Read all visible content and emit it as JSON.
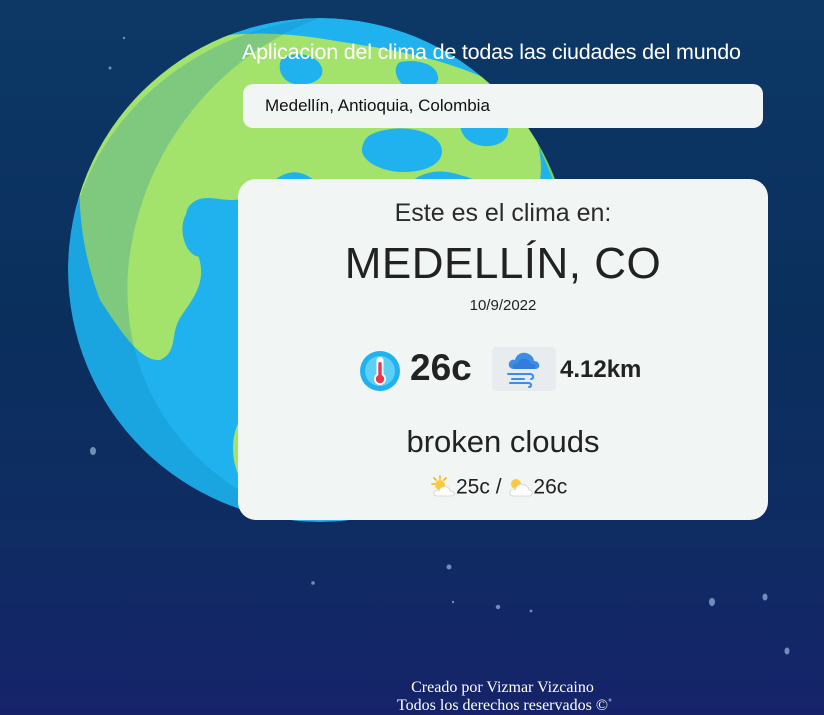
{
  "header": {
    "title": "Aplicacion del clima de todas las ciudades del mundo"
  },
  "search": {
    "value": "Medellín, Antioquia, Colombia",
    "placeholder": ""
  },
  "weather_card": {
    "heading": "Este es el clima en:",
    "city": "MEDELLÍN, CO",
    "date": "10/9/2022",
    "temperature": "26c",
    "wind": "4.12km",
    "description": "broken clouds",
    "min_temp": "25c",
    "separator": "/",
    "max_temp": "26c"
  },
  "icons": {
    "background": "earth-globe-icon",
    "temperature": "thermometer-icon",
    "wind": "cloud-wind-icon",
    "min": "sun-behind-cloud-icon",
    "max": "sun-behind-large-cloud-icon"
  },
  "footer": {
    "line1": "Creado por Vizmar Vizcaino",
    "line2": "Todos los derechos reservados ©"
  },
  "colors": {
    "background_top": "#0d3866",
    "background_bottom": "#16236a",
    "earth_ocean": "#1fb2ee",
    "earth_land": "#a3e26b",
    "card": "#f1f5f4",
    "text_dark": "#222222",
    "text_light": "#ffffff"
  }
}
